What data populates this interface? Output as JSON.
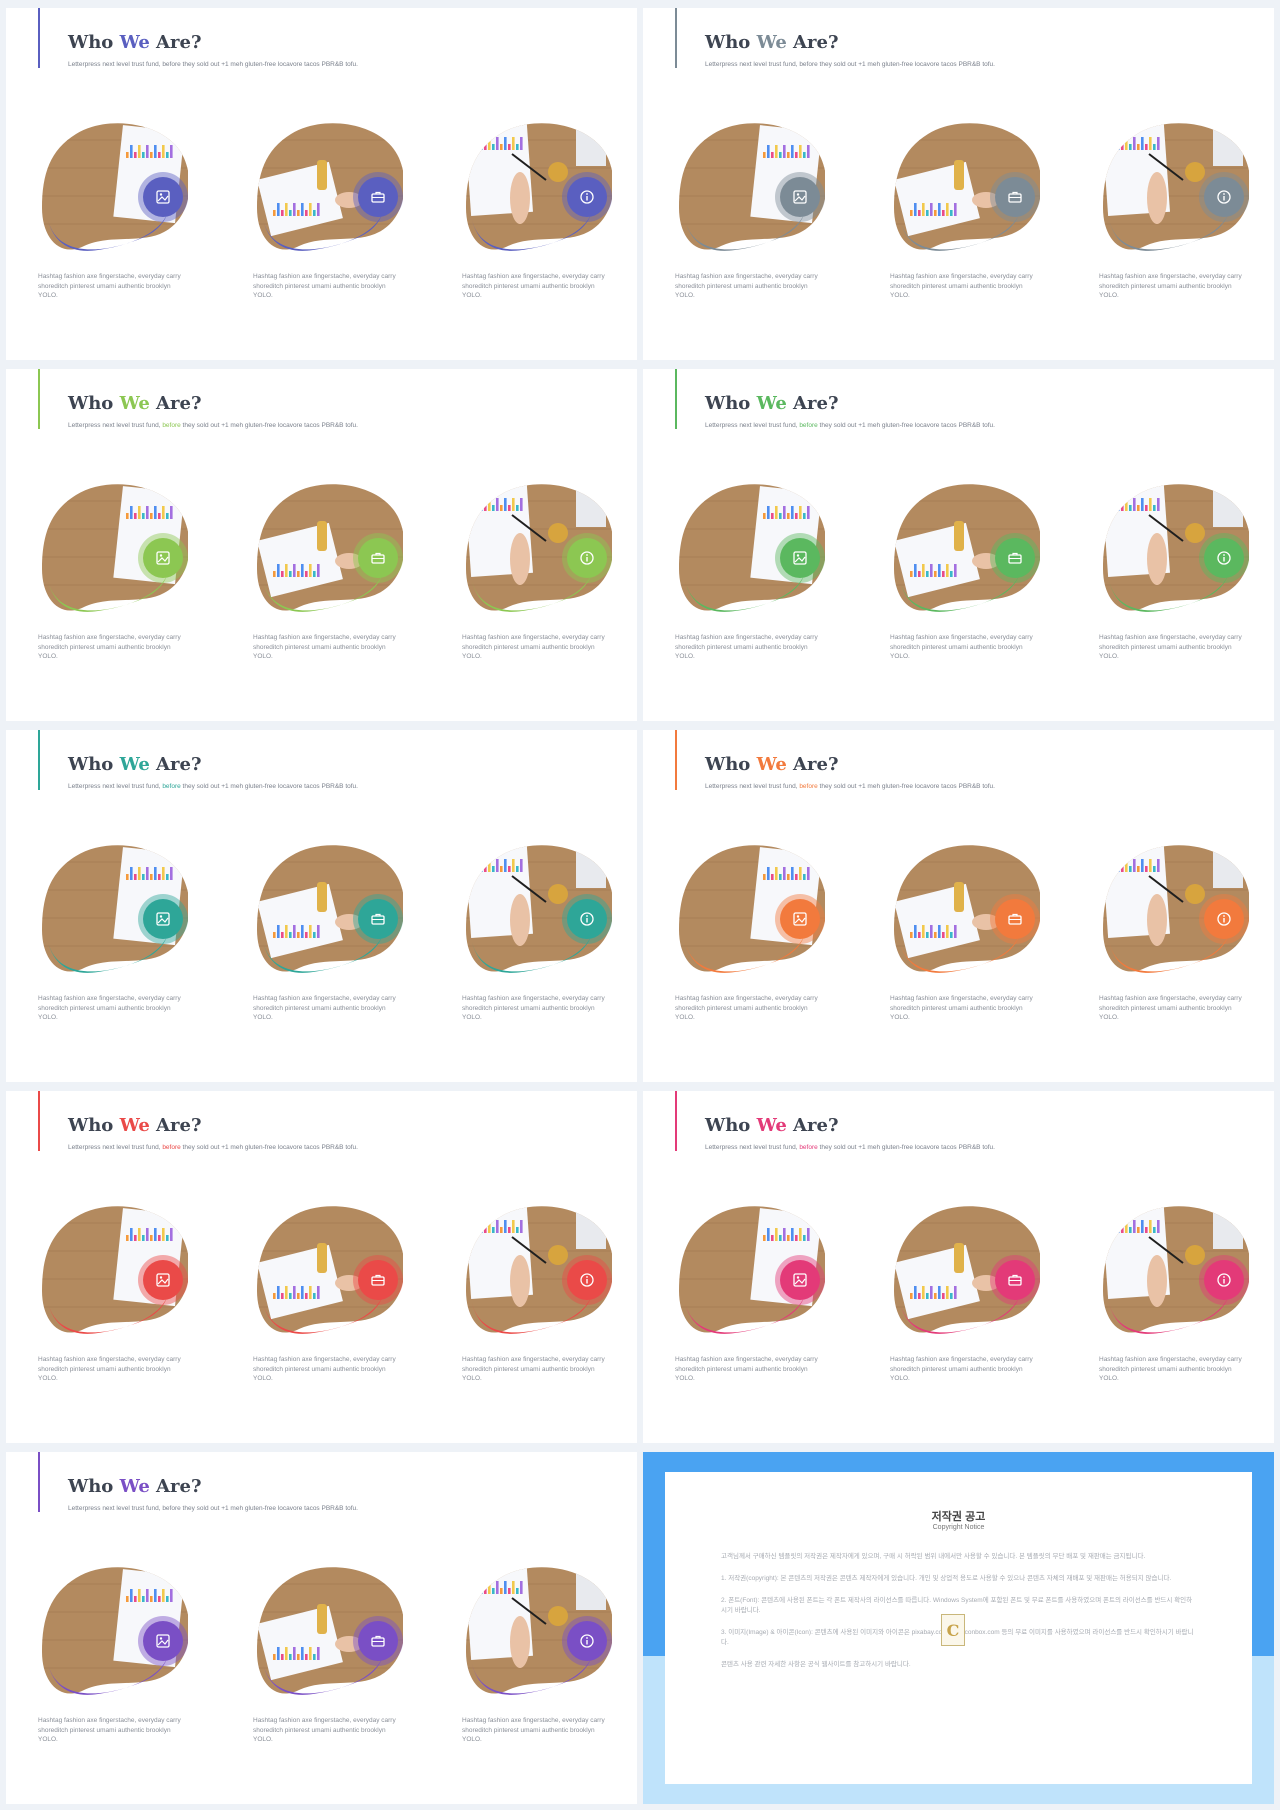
{
  "slide_template": {
    "title_prefix": "Who ",
    "title_highlight": "We",
    "title_suffix": " Are?",
    "subtitle_prefix": "Letterpress next level trust fund, ",
    "subtitle_highlight": "before",
    "subtitle_suffix": " they sold out +1 meh gluten-free locavore tacos PBR&B tofu.",
    "card_description": "Hashtag fashion axe fingerstache, everyday carry shoreditch pinterest umami authentic brooklyn YOLO.",
    "card_icons": [
      "image-icon",
      "briefcase-icon",
      "info-icon"
    ]
  },
  "slides": [
    {
      "accent": "#5a5fc0",
      "subtitle_highlight_colored": false
    },
    {
      "accent": "#7c8b96",
      "subtitle_highlight_colored": false
    },
    {
      "accent": "#8cc752",
      "subtitle_highlight_colored": true
    },
    {
      "accent": "#5bb85f",
      "subtitle_highlight_colored": true
    },
    {
      "accent": "#2ea698",
      "subtitle_highlight_colored": true
    },
    {
      "accent": "#f27a3d",
      "subtitle_highlight_colored": true
    },
    {
      "accent": "#ea4a48",
      "subtitle_highlight_colored": true
    },
    {
      "accent": "#e33a78",
      "subtitle_highlight_colored": true
    },
    {
      "accent": "#7a4fc5",
      "subtitle_highlight_colored": false
    }
  ],
  "copyright": {
    "title": "저작권 공고",
    "subtitle": "Copyright Notice",
    "logo_letter": "C",
    "paragraphs": [
      "고객님께서 구매하신 템플릿의 저작권은 제작자에게 있으며, 구매 시 허락된 범위 내에서만 사용할 수 있습니다. 본 템플릿의 무단 배포 및 재판매는 금지됩니다.",
      "1. 저작권(copyright): 본 콘텐츠의 저작권은 콘텐츠 제작자에게 있습니다. 개인 및 상업적 용도로 사용할 수 있으나 콘텐츠 자체의 재배포 및 재판매는 허용되지 않습니다.",
      "2. 폰트(Font): 콘텐츠에 사용된 폰트는 각 폰트 제작사의 라이선스를 따릅니다. Windows System에 포함된 폰트 및 무료 폰트를 사용하였으며 폰트의 라이선스를 반드시 확인하시기 바랍니다.",
      "3. 이미지(Image) & 아이콘(Icon): 콘텐츠에 사용된 이미지와 아이콘은 pixabay.com, webiconbox.com 등의 무료 이미지를 사용하였으며 라이선스를 반드시 확인하시기 바랍니다.",
      "콘텐츠 사용 관련 자세한 사항은 공식 웹사이트를 참고하시기 바랍니다."
    ]
  }
}
